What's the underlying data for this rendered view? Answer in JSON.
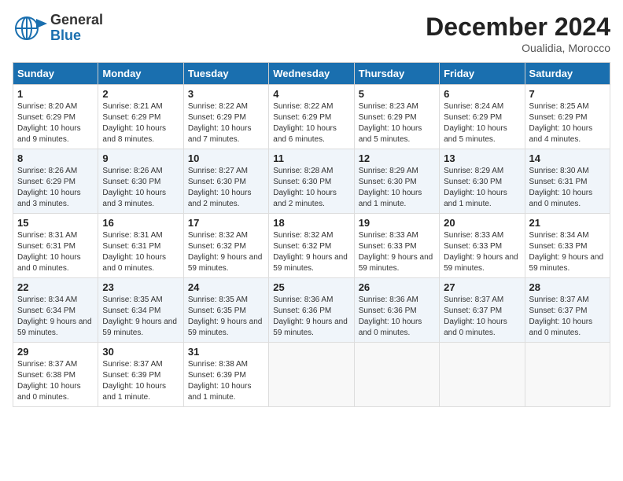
{
  "header": {
    "logo_general": "General",
    "logo_blue": "Blue",
    "month_year": "December 2024",
    "location": "Oualidia, Morocco"
  },
  "weekdays": [
    "Sunday",
    "Monday",
    "Tuesday",
    "Wednesday",
    "Thursday",
    "Friday",
    "Saturday"
  ],
  "weeks": [
    [
      {
        "day": "1",
        "sunrise": "Sunrise: 8:20 AM",
        "sunset": "Sunset: 6:29 PM",
        "daylight": "Daylight: 10 hours and 9 minutes."
      },
      {
        "day": "2",
        "sunrise": "Sunrise: 8:21 AM",
        "sunset": "Sunset: 6:29 PM",
        "daylight": "Daylight: 10 hours and 8 minutes."
      },
      {
        "day": "3",
        "sunrise": "Sunrise: 8:22 AM",
        "sunset": "Sunset: 6:29 PM",
        "daylight": "Daylight: 10 hours and 7 minutes."
      },
      {
        "day": "4",
        "sunrise": "Sunrise: 8:22 AM",
        "sunset": "Sunset: 6:29 PM",
        "daylight": "Daylight: 10 hours and 6 minutes."
      },
      {
        "day": "5",
        "sunrise": "Sunrise: 8:23 AM",
        "sunset": "Sunset: 6:29 PM",
        "daylight": "Daylight: 10 hours and 5 minutes."
      },
      {
        "day": "6",
        "sunrise": "Sunrise: 8:24 AM",
        "sunset": "Sunset: 6:29 PM",
        "daylight": "Daylight: 10 hours and 5 minutes."
      },
      {
        "day": "7",
        "sunrise": "Sunrise: 8:25 AM",
        "sunset": "Sunset: 6:29 PM",
        "daylight": "Daylight: 10 hours and 4 minutes."
      }
    ],
    [
      {
        "day": "8",
        "sunrise": "Sunrise: 8:26 AM",
        "sunset": "Sunset: 6:29 PM",
        "daylight": "Daylight: 10 hours and 3 minutes."
      },
      {
        "day": "9",
        "sunrise": "Sunrise: 8:26 AM",
        "sunset": "Sunset: 6:30 PM",
        "daylight": "Daylight: 10 hours and 3 minutes."
      },
      {
        "day": "10",
        "sunrise": "Sunrise: 8:27 AM",
        "sunset": "Sunset: 6:30 PM",
        "daylight": "Daylight: 10 hours and 2 minutes."
      },
      {
        "day": "11",
        "sunrise": "Sunrise: 8:28 AM",
        "sunset": "Sunset: 6:30 PM",
        "daylight": "Daylight: 10 hours and 2 minutes."
      },
      {
        "day": "12",
        "sunrise": "Sunrise: 8:29 AM",
        "sunset": "Sunset: 6:30 PM",
        "daylight": "Daylight: 10 hours and 1 minute."
      },
      {
        "day": "13",
        "sunrise": "Sunrise: 8:29 AM",
        "sunset": "Sunset: 6:30 PM",
        "daylight": "Daylight: 10 hours and 1 minute."
      },
      {
        "day": "14",
        "sunrise": "Sunrise: 8:30 AM",
        "sunset": "Sunset: 6:31 PM",
        "daylight": "Daylight: 10 hours and 0 minutes."
      }
    ],
    [
      {
        "day": "15",
        "sunrise": "Sunrise: 8:31 AM",
        "sunset": "Sunset: 6:31 PM",
        "daylight": "Daylight: 10 hours and 0 minutes."
      },
      {
        "day": "16",
        "sunrise": "Sunrise: 8:31 AM",
        "sunset": "Sunset: 6:31 PM",
        "daylight": "Daylight: 10 hours and 0 minutes."
      },
      {
        "day": "17",
        "sunrise": "Sunrise: 8:32 AM",
        "sunset": "Sunset: 6:32 PM",
        "daylight": "Daylight: 9 hours and 59 minutes."
      },
      {
        "day": "18",
        "sunrise": "Sunrise: 8:32 AM",
        "sunset": "Sunset: 6:32 PM",
        "daylight": "Daylight: 9 hours and 59 minutes."
      },
      {
        "day": "19",
        "sunrise": "Sunrise: 8:33 AM",
        "sunset": "Sunset: 6:33 PM",
        "daylight": "Daylight: 9 hours and 59 minutes."
      },
      {
        "day": "20",
        "sunrise": "Sunrise: 8:33 AM",
        "sunset": "Sunset: 6:33 PM",
        "daylight": "Daylight: 9 hours and 59 minutes."
      },
      {
        "day": "21",
        "sunrise": "Sunrise: 8:34 AM",
        "sunset": "Sunset: 6:33 PM",
        "daylight": "Daylight: 9 hours and 59 minutes."
      }
    ],
    [
      {
        "day": "22",
        "sunrise": "Sunrise: 8:34 AM",
        "sunset": "Sunset: 6:34 PM",
        "daylight": "Daylight: 9 hours and 59 minutes."
      },
      {
        "day": "23",
        "sunrise": "Sunrise: 8:35 AM",
        "sunset": "Sunset: 6:34 PM",
        "daylight": "Daylight: 9 hours and 59 minutes."
      },
      {
        "day": "24",
        "sunrise": "Sunrise: 8:35 AM",
        "sunset": "Sunset: 6:35 PM",
        "daylight": "Daylight: 9 hours and 59 minutes."
      },
      {
        "day": "25",
        "sunrise": "Sunrise: 8:36 AM",
        "sunset": "Sunset: 6:36 PM",
        "daylight": "Daylight: 9 hours and 59 minutes."
      },
      {
        "day": "26",
        "sunrise": "Sunrise: 8:36 AM",
        "sunset": "Sunset: 6:36 PM",
        "daylight": "Daylight: 10 hours and 0 minutes."
      },
      {
        "day": "27",
        "sunrise": "Sunrise: 8:37 AM",
        "sunset": "Sunset: 6:37 PM",
        "daylight": "Daylight: 10 hours and 0 minutes."
      },
      {
        "day": "28",
        "sunrise": "Sunrise: 8:37 AM",
        "sunset": "Sunset: 6:37 PM",
        "daylight": "Daylight: 10 hours and 0 minutes."
      }
    ],
    [
      {
        "day": "29",
        "sunrise": "Sunrise: 8:37 AM",
        "sunset": "Sunset: 6:38 PM",
        "daylight": "Daylight: 10 hours and 0 minutes."
      },
      {
        "day": "30",
        "sunrise": "Sunrise: 8:37 AM",
        "sunset": "Sunset: 6:39 PM",
        "daylight": "Daylight: 10 hours and 1 minute."
      },
      {
        "day": "31",
        "sunrise": "Sunrise: 8:38 AM",
        "sunset": "Sunset: 6:39 PM",
        "daylight": "Daylight: 10 hours and 1 minute."
      },
      null,
      null,
      null,
      null
    ]
  ]
}
